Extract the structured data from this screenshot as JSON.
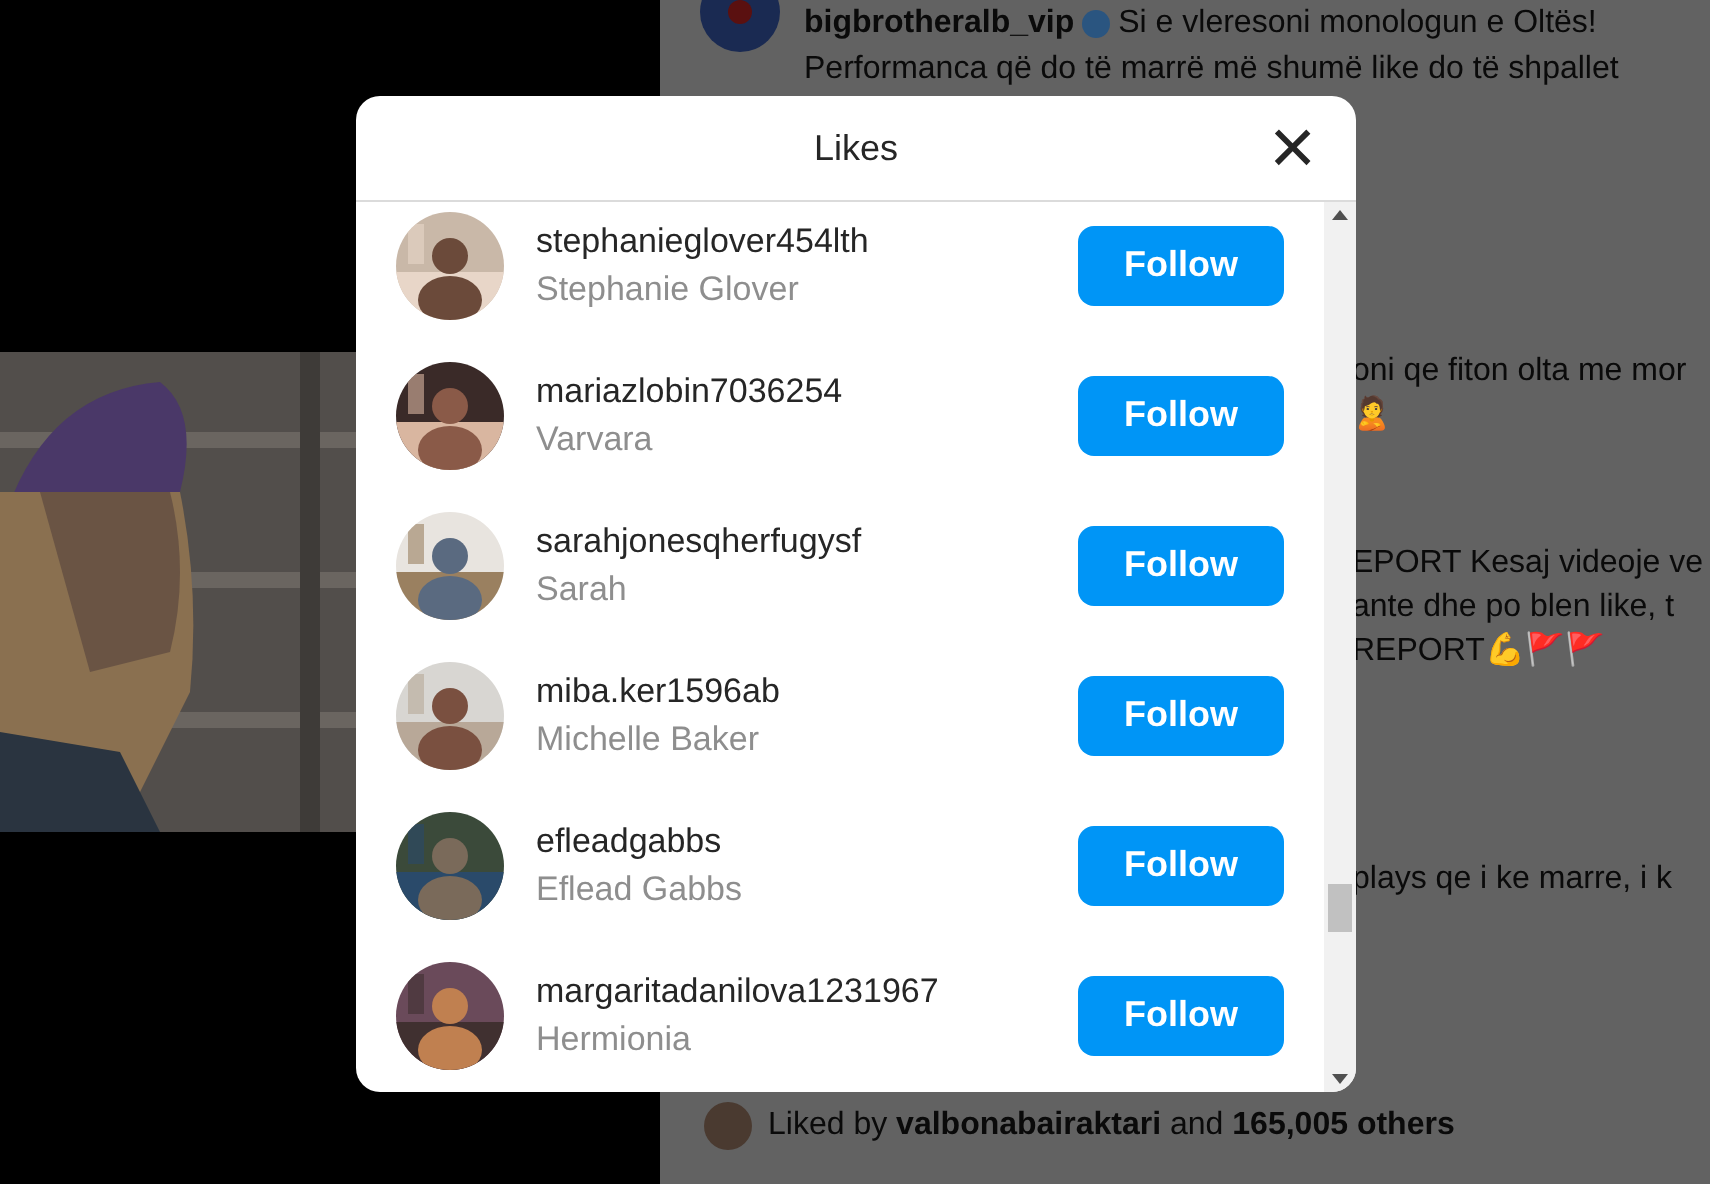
{
  "post": {
    "author": "bigbrotheralb_vip",
    "verified": true,
    "caption": "Si e vleresoni monologun e Oltës!",
    "caption_2": "Performanca që do të marrë më shumë like do të shpallet",
    "comments": [
      {
        "lines": [
          "oni qe fiton olta me mor",
          "🙎"
        ]
      },
      {
        "lines": [
          "EPORT Kesaj videoje ve",
          "ante dhe po blen like, t",
          "REPORT💪🚩🚩"
        ]
      },
      {
        "lines": [
          "plays qe i ke marre, i k"
        ]
      }
    ],
    "liked_by": {
      "prefix": "Liked by",
      "user": "valbonabairaktari",
      "middle": "and",
      "count": "165,005 others"
    }
  },
  "modal": {
    "title": "Likes",
    "close": "×",
    "users": [
      {
        "username": "stephanieglover454lth",
        "name": "Stephanie Glover",
        "button": "Follow",
        "following": false
      },
      {
        "username": "mariazlobin7036254",
        "name": "Varvara",
        "button": "Follow",
        "following": false
      },
      {
        "username": "sarahjonesqherfugysf",
        "name": "Sarah",
        "button": "Follow",
        "following": false
      },
      {
        "username": "miba.ker1596ab",
        "name": "Michelle Baker",
        "button": "Follow",
        "following": false
      },
      {
        "username": "efleadgabbs",
        "name": "Eflead Gabbs",
        "button": "Follow",
        "following": false
      },
      {
        "username": "margaritadanilova1231967",
        "name": "Hermionia",
        "button": "Follow",
        "following": false
      }
    ]
  }
}
